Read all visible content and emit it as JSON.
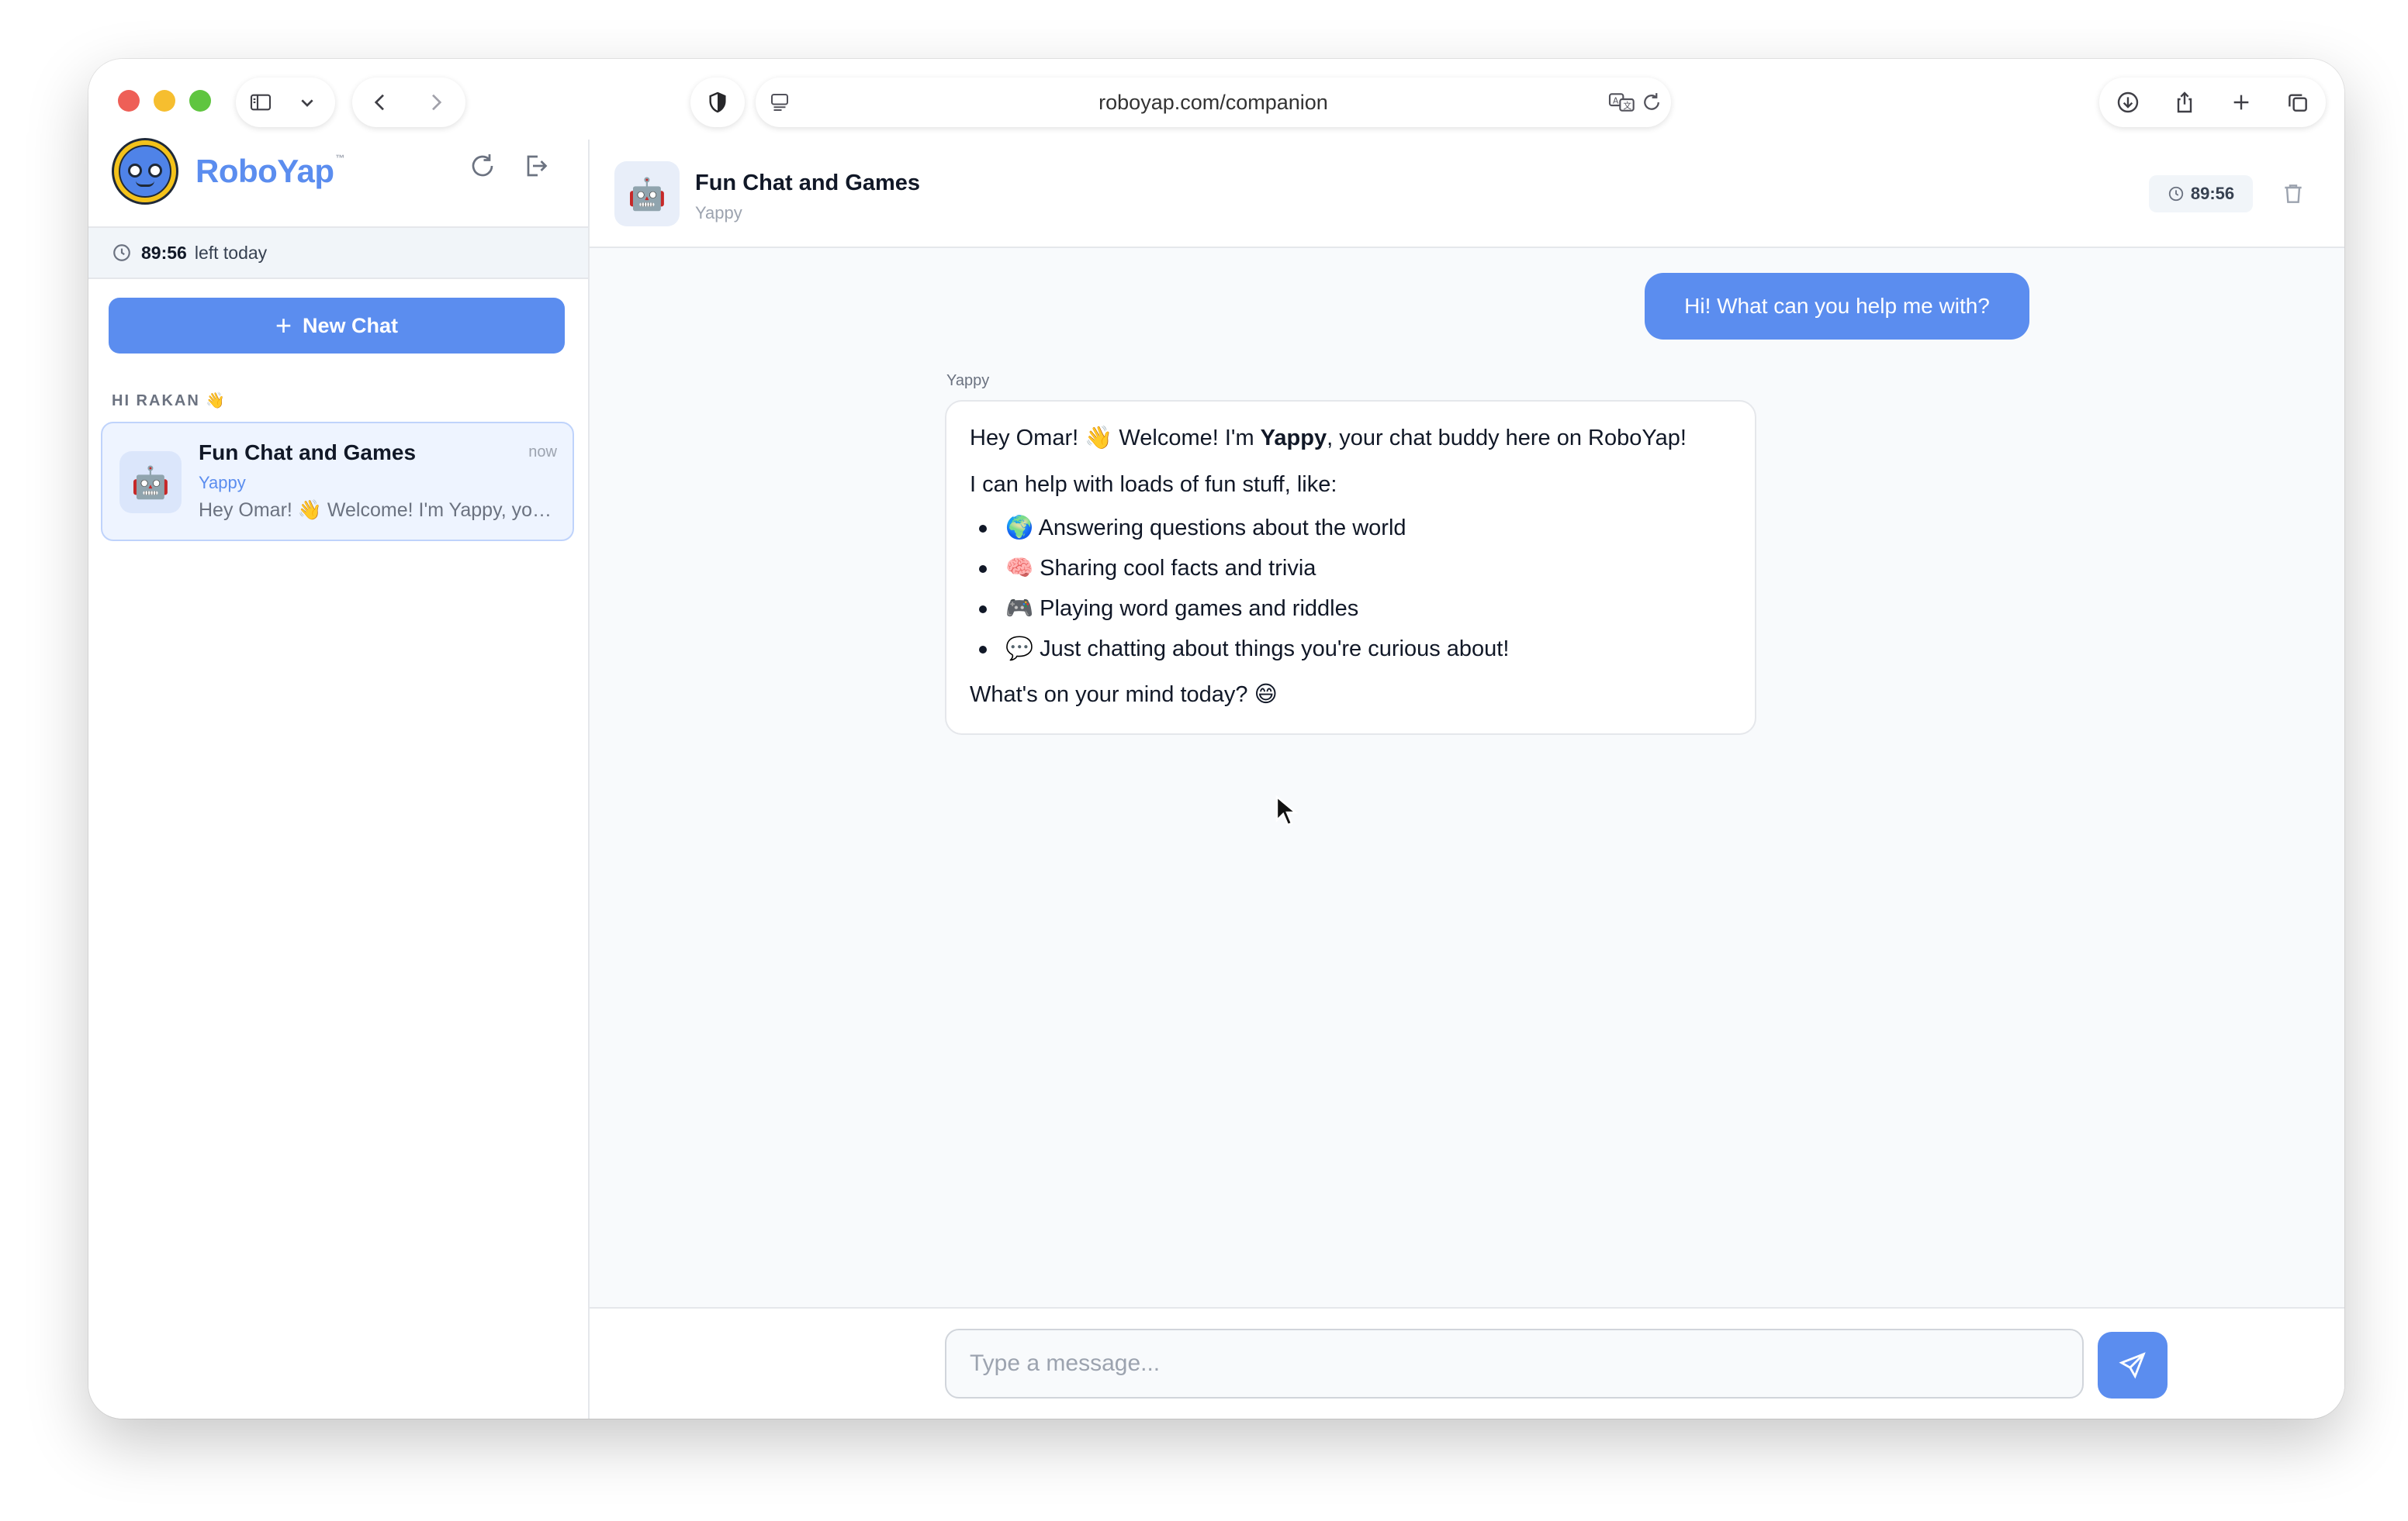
{
  "browser": {
    "url": "roboyap.com/companion"
  },
  "sidebar": {
    "brand_name": "RoboYap",
    "brand_tm": "™",
    "timer_value": "89:56",
    "timer_label": "left today",
    "new_chat_label": "New Chat",
    "greeting": "HI RAKAN 👋",
    "conversations": [
      {
        "title": "Fun Chat and Games",
        "bot": "Yappy",
        "time": "now",
        "preview": "Hey Omar! 👋 Welcome! I'm Yappy, your chat buddy here on RoboYap!",
        "avatar": "🤖"
      }
    ]
  },
  "header": {
    "title": "Fun Chat and Games",
    "subtitle": "Yappy",
    "avatar": "🤖",
    "timer": "89:56"
  },
  "messages": {
    "user_text": "Hi! What can you help me with?",
    "bot_name": "Yappy",
    "bot_intro_a": "Hey Omar! 👋 Welcome! I'm ",
    "bot_intro_bold": "Yappy",
    "bot_intro_b": ", your chat buddy here on RoboYap!",
    "bot_list_intro": "I can help with loads of fun stuff, like:",
    "bot_list": [
      "🌍 Answering questions about the world",
      "🧠 Sharing cool facts and trivia",
      "🎮 Playing word games and riddles",
      "💬 Just chatting about things you're curious about!"
    ],
    "bot_outro": "What's on your mind today? 😄"
  },
  "composer": {
    "placeholder": "Type a message..."
  },
  "colors": {
    "accent": "#5b8def",
    "logo_yellow": "#f3c21a"
  },
  "icons": [
    "sidebar-toggle-icon",
    "chevron-down-icon",
    "back-arrow-icon",
    "forward-arrow-icon",
    "shield-icon",
    "reader-icon",
    "translate-icon",
    "reload-icon",
    "download-icon",
    "share-icon",
    "plus-icon",
    "tabs-icon",
    "refresh-icon",
    "logout-icon",
    "clock-icon",
    "trash-icon",
    "send-icon",
    "cursor-icon"
  ]
}
